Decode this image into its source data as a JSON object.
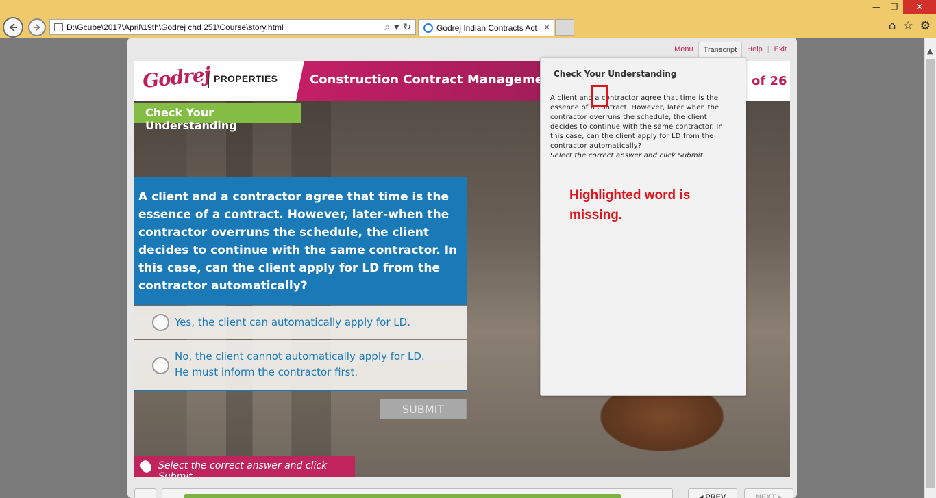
{
  "browser": {
    "address": "D:\\Gcube\\2017\\April\\19th\\Godrej chd 251\\Course\\story.html",
    "tab_title": "Godrej Indian Contracts Act",
    "tab_close": "×",
    "win_min": "—",
    "win_max": "❐",
    "win_close": "✕",
    "icons": [
      "back-arrow",
      "forward-arrow",
      "search",
      "refresh",
      "home",
      "favorites-star",
      "settings-gear"
    ]
  },
  "top_menu": {
    "menu": "Menu",
    "transcript": "Transcript",
    "help": "Help",
    "separator": "|",
    "exit": "Exit"
  },
  "header": {
    "logo_mark": "Godrej",
    "logo_text": "PROPERTIES",
    "course_title": "Construction Contract Management Tra",
    "page_count": "of 26"
  },
  "slide": {
    "section_tag": "Check Your Understanding",
    "question": "A client and a contractor agree that time is the essence of a contract. However, later-when the contractor overruns the schedule, the client decides to continue with the same contractor. In this case, can the client apply for LD from the contractor automatically?",
    "options": [
      {
        "line1": "Yes, the client can automatically apply for LD.",
        "line2": ""
      },
      {
        "line1": "No, the client cannot automatically apply for LD.",
        "line2": "He must inform the contractor first."
      }
    ],
    "submit_label": "SUBMIT",
    "instruction": "Select the correct answer and click Submit."
  },
  "controls": {
    "prev_label": "◂ PREV",
    "next_label": "NEXT ▸",
    "progress_percent": 91
  },
  "transcript": {
    "title": "Check Your Understanding",
    "body": "A client and a contractor agree that time is the essence of a contract. However, later when the contractor overruns the schedule, the client decides to continue with the same contractor. In this case, can the client apply for LD from the contractor automatically?",
    "instruction": "Select the correct answer and click Submit."
  },
  "annotation": {
    "text": "Highlighted word is missing.",
    "color": "#e0141c"
  },
  "colors": {
    "brand_magenta": "#c0245c",
    "question_blue": "#1a7ab8",
    "tag_green": "#84bd44",
    "chrome_yellow": "#f0c96a"
  }
}
